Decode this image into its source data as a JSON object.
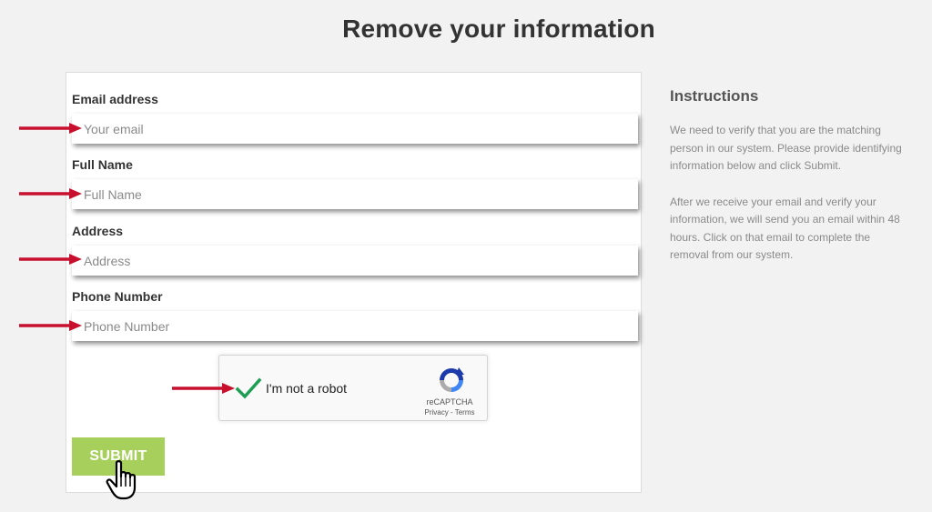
{
  "page": {
    "title": "Remove your information"
  },
  "form": {
    "fields": [
      {
        "label": "Email address",
        "placeholder": "Your email"
      },
      {
        "label": "Full Name",
        "placeholder": "Full Name"
      },
      {
        "label": "Address",
        "placeholder": "Address"
      },
      {
        "label": "Phone Number",
        "placeholder": "Phone Number"
      }
    ],
    "recaptcha": {
      "label": "I'm not a robot",
      "checked": true,
      "brand": "reCAPTCHA",
      "links": "Privacy - Terms"
    },
    "submit_label": "SUBMIT"
  },
  "instructions": {
    "title": "Instructions",
    "paragraphs": [
      "We need to verify that you are the matching person in our system. Please provide identifying information below and click Submit.",
      "After we receive your email and verify your information, we will send you an email within 48 hours. Click on that email to complete the removal from our system."
    ]
  },
  "colors": {
    "submit": "#a6cf5b",
    "arrow": "#c8102e",
    "checkmark": "#1e9e55"
  },
  "icons": [
    "arrow-right-icon",
    "checkmark-icon",
    "recaptcha-logo-icon",
    "hand-pointer-icon"
  ]
}
